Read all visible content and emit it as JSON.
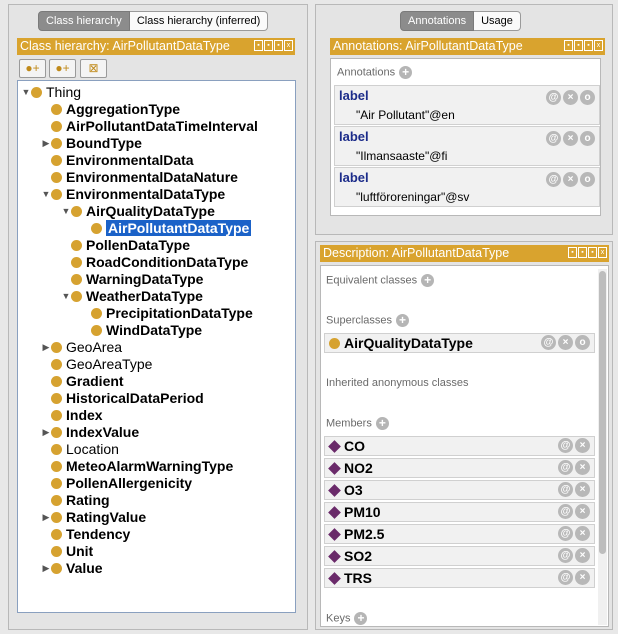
{
  "left": {
    "tabs": [
      "Class hierarchy",
      "Class hierarchy (inferred)"
    ],
    "title": "Class hierarchy: AirPollutantDataType",
    "toolbar": [
      "add-subclass-icon",
      "add-sibling-icon",
      "delete-class-icon"
    ],
    "tree": [
      {
        "label": "Thing",
        "expand": "open",
        "bold": false
      },
      {
        "label": "AggregationType",
        "expand": "",
        "bold": true
      },
      {
        "label": "AirPollutantDataTimeInterval",
        "expand": "",
        "bold": true
      },
      {
        "label": "BoundType",
        "expand": "closed",
        "bold": true
      },
      {
        "label": "EnvironmentalData",
        "expand": "",
        "bold": true
      },
      {
        "label": "EnvironmentalDataNature",
        "expand": "",
        "bold": true
      },
      {
        "label": "EnvironmentalDataType",
        "expand": "open",
        "bold": true
      },
      {
        "label": "AirQualityDataType",
        "expand": "open",
        "bold": true
      },
      {
        "label": "AirPollutantDataType",
        "expand": "",
        "bold": true,
        "selected": true
      },
      {
        "label": "PollenDataType",
        "expand": "",
        "bold": true
      },
      {
        "label": "RoadConditionDataType",
        "expand": "",
        "bold": true
      },
      {
        "label": "WarningDataType",
        "expand": "",
        "bold": true
      },
      {
        "label": "WeatherDataType",
        "expand": "open",
        "bold": true
      },
      {
        "label": "PrecipitationDataType",
        "expand": "",
        "bold": true
      },
      {
        "label": "WindDataType",
        "expand": "",
        "bold": true
      },
      {
        "label": "GeoArea",
        "expand": "closed",
        "bold": false
      },
      {
        "label": "GeoAreaType",
        "expand": "",
        "bold": false
      },
      {
        "label": "Gradient",
        "expand": "",
        "bold": true
      },
      {
        "label": "HistoricalDataPeriod",
        "expand": "",
        "bold": true
      },
      {
        "label": "Index",
        "expand": "",
        "bold": true
      },
      {
        "label": "IndexValue",
        "expand": "closed",
        "bold": true
      },
      {
        "label": "Location",
        "expand": "",
        "bold": false
      },
      {
        "label": "MeteoAlarmWarningType",
        "expand": "",
        "bold": true
      },
      {
        "label": "PollenAllergenicity",
        "expand": "",
        "bold": true
      },
      {
        "label": "Rating",
        "expand": "",
        "bold": true
      },
      {
        "label": "RatingValue",
        "expand": "closed",
        "bold": true
      },
      {
        "label": "Tendency",
        "expand": "",
        "bold": true
      },
      {
        "label": "Unit",
        "expand": "",
        "bold": true
      },
      {
        "label": "Value",
        "expand": "closed",
        "bold": true
      }
    ]
  },
  "annotations_panel": {
    "tabs": [
      "Annotations",
      "Usage"
    ],
    "title": "Annotations: AirPollutantDataType",
    "section_label": "Annotations",
    "items": [
      {
        "property": "label",
        "value": "\"Air Pollutant\"@en"
      },
      {
        "property": "label",
        "value": "\"Ilmansaaste\"@fi"
      },
      {
        "property": "label",
        "value": "\"luftföroreningar\"@sv"
      }
    ]
  },
  "description_panel": {
    "title": "Description: AirPollutantDataType",
    "equivalent_label": "Equivalent classes",
    "superclasses_label": "Superclasses",
    "superclass": "AirQualityDataType",
    "inherited_label": "Inherited anonymous classes",
    "members_label": "Members",
    "members": [
      "CO",
      "NO2",
      "O3",
      "PM10",
      "PM2.5",
      "SO2",
      "TRS"
    ],
    "keys_label": "Keys"
  },
  "colors": {
    "title_bar": "#d9a32e",
    "class_dot": "#d6a230",
    "selection": "#1b62c8",
    "individual": "#6a2a6a",
    "annotation_property": "#1c2c8a"
  }
}
